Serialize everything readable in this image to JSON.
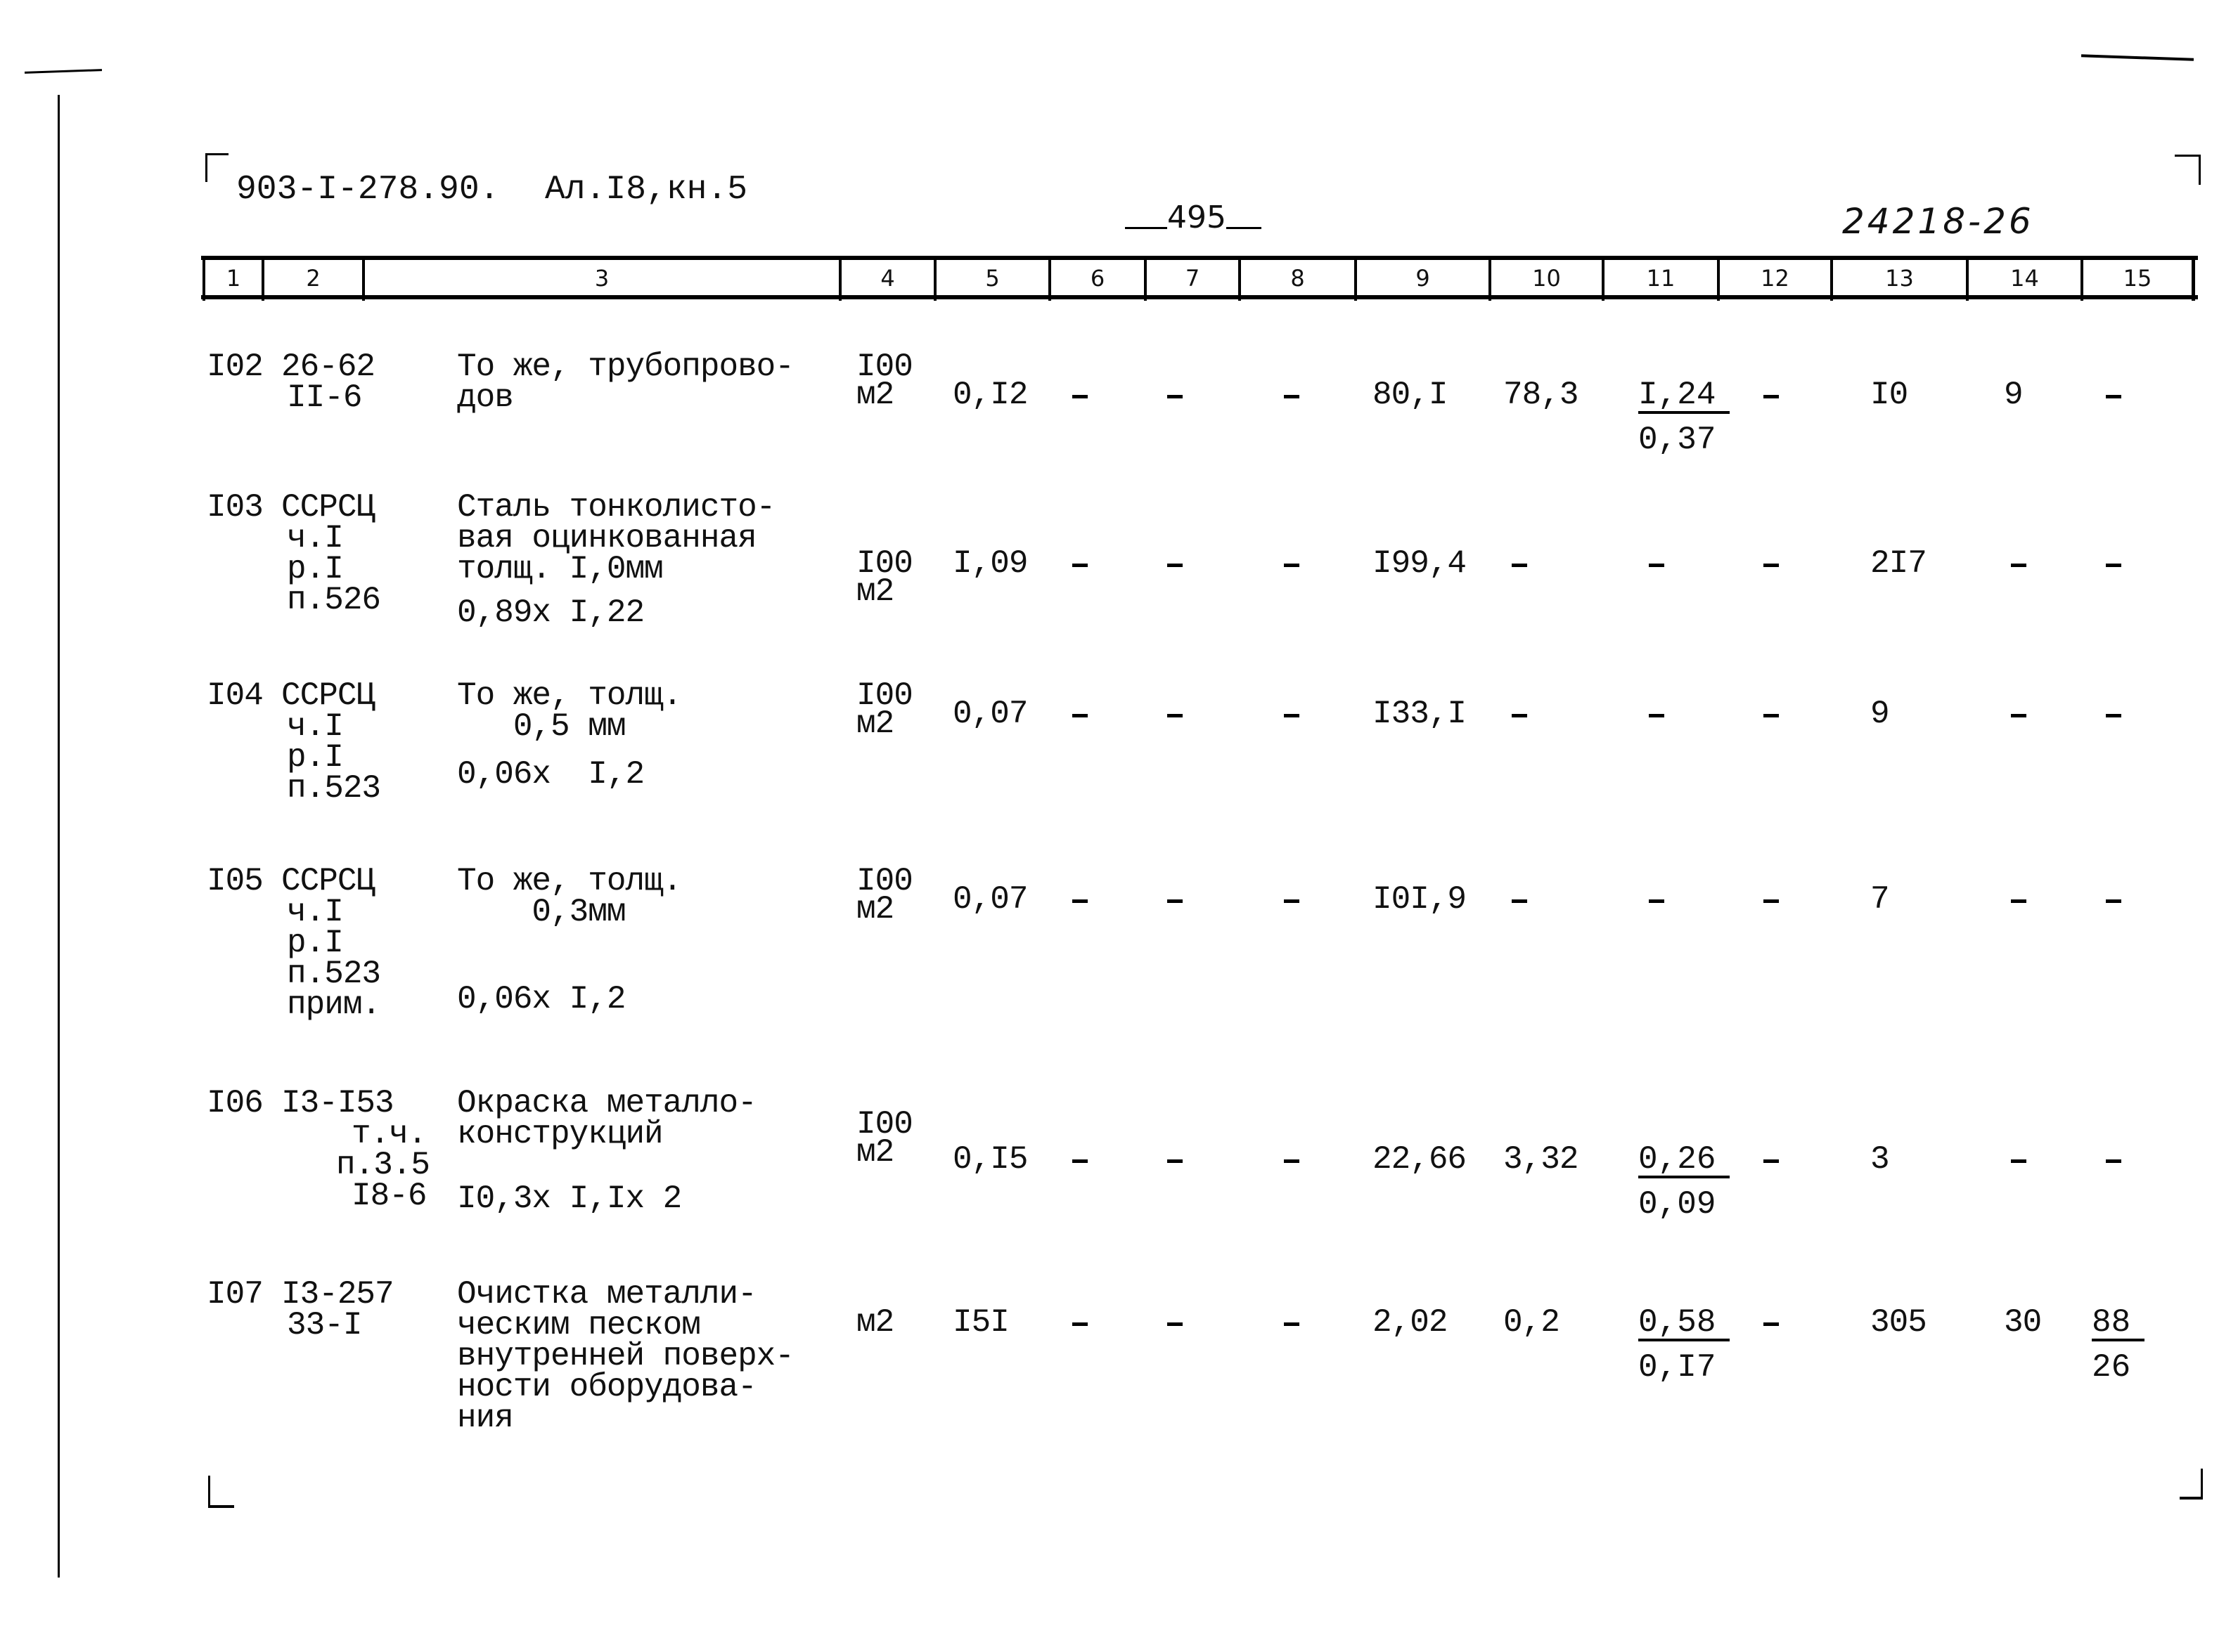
{
  "document": {
    "header_code": "903-I-278.90.",
    "header_album": "Ал.I8,кн.5",
    "page_number": "495",
    "handwritten_ref": "24218-26"
  },
  "table": {
    "columns": [
      "1",
      "2",
      "3",
      "4",
      "5",
      "6",
      "7",
      "8",
      "9",
      "10",
      "11",
      "12",
      "13",
      "14",
      "15"
    ],
    "rows": [
      {
        "no": "I02",
        "code": [
          "26-62",
          "II-6"
        ],
        "name": [
          "То же, трубопрово-",
          "дов"
        ],
        "formula": "",
        "unit": [
          "I00",
          "м2"
        ],
        "qty": "0,I2",
        "c6": "-",
        "c7": "-",
        "c8": "-",
        "c9": "80,I",
        "c10": "78,3",
        "c11": {
          "num": "I,24",
          "den": "0,37"
        },
        "c12": "-",
        "c13": "I0",
        "c14": "9",
        "c15": "-"
      },
      {
        "no": "I03",
        "code": [
          "ССРСЦ",
          "ч.I",
          "р.I",
          "п.526"
        ],
        "name": [
          "Сталь тонколисто-",
          "вая оцинкованная",
          "толщ. I,0мм"
        ],
        "formula": "0,89х I,22",
        "unit": [
          "I00",
          "м2"
        ],
        "qty": "I,09",
        "c6": "-",
        "c7": "-",
        "c8": "-",
        "c9": "I99,4",
        "c10": "-",
        "c11": "-",
        "c12": "-",
        "c13": "2I7",
        "c14": "-",
        "c15": "-"
      },
      {
        "no": "I04",
        "code": [
          "ССРСЦ",
          "ч.I",
          "р.I",
          "п.523"
        ],
        "name": [
          "То же, толщ.",
          "   0,5 мм"
        ],
        "formula": "0,06х  I,2",
        "unit": [
          "I00",
          "м2"
        ],
        "qty": "0,07",
        "c6": "-",
        "c7": "-",
        "c8": "-",
        "c9": "I33,I",
        "c10": "-",
        "c11": "-",
        "c12": "-",
        "c13": "9",
        "c14": "-",
        "c15": "-"
      },
      {
        "no": "I05",
        "code": [
          "ССРСЦ",
          "ч.I",
          "р.I",
          "п.523",
          "прим."
        ],
        "name": [
          "То же, толщ.",
          "    0,3мм"
        ],
        "formula": "0,06х I,2",
        "unit": [
          "I00",
          "м2"
        ],
        "qty": "0,07",
        "c6": "-",
        "c7": "-",
        "c8": "-",
        "c9": "I0I,9",
        "c10": "-",
        "c11": "-",
        "c12": "-",
        "c13": "7",
        "c14": "-",
        "c15": "-"
      },
      {
        "no": "I06",
        "code": [
          "I3-I53",
          "т.ч.",
          "п.3.5",
          "I8-6"
        ],
        "name": [
          "Окраска металло-",
          "конструкций"
        ],
        "formula": "I0,3х I,Iх 2",
        "unit": [
          "I00",
          "м2"
        ],
        "qty": "0,I5",
        "c6": "-",
        "c7": "-",
        "c8": "-",
        "c9": "22,66",
        "c10": "3,32",
        "c11": {
          "num": "0,26",
          "den": "0,09"
        },
        "c12": "-",
        "c13": "3",
        "c14": "-",
        "c15": "-"
      },
      {
        "no": "I07",
        "code": [
          "I3-257",
          "33-I"
        ],
        "name": [
          "Очистка металли-",
          "ческим песком",
          "внутренней поверх-",
          "ности оборудова-",
          "ния"
        ],
        "formula": "",
        "unit": [
          "м2"
        ],
        "qty": "I5I",
        "c6": "-",
        "c7": "-",
        "c8": "-",
        "c9": "2,02",
        "c10": "0,2",
        "c11": {
          "num": "0,58",
          "den": "0,I7"
        },
        "c12": "-",
        "c13": "305",
        "c14": "30",
        "c15": {
          "num": "88",
          "den": "26"
        }
      }
    ]
  }
}
